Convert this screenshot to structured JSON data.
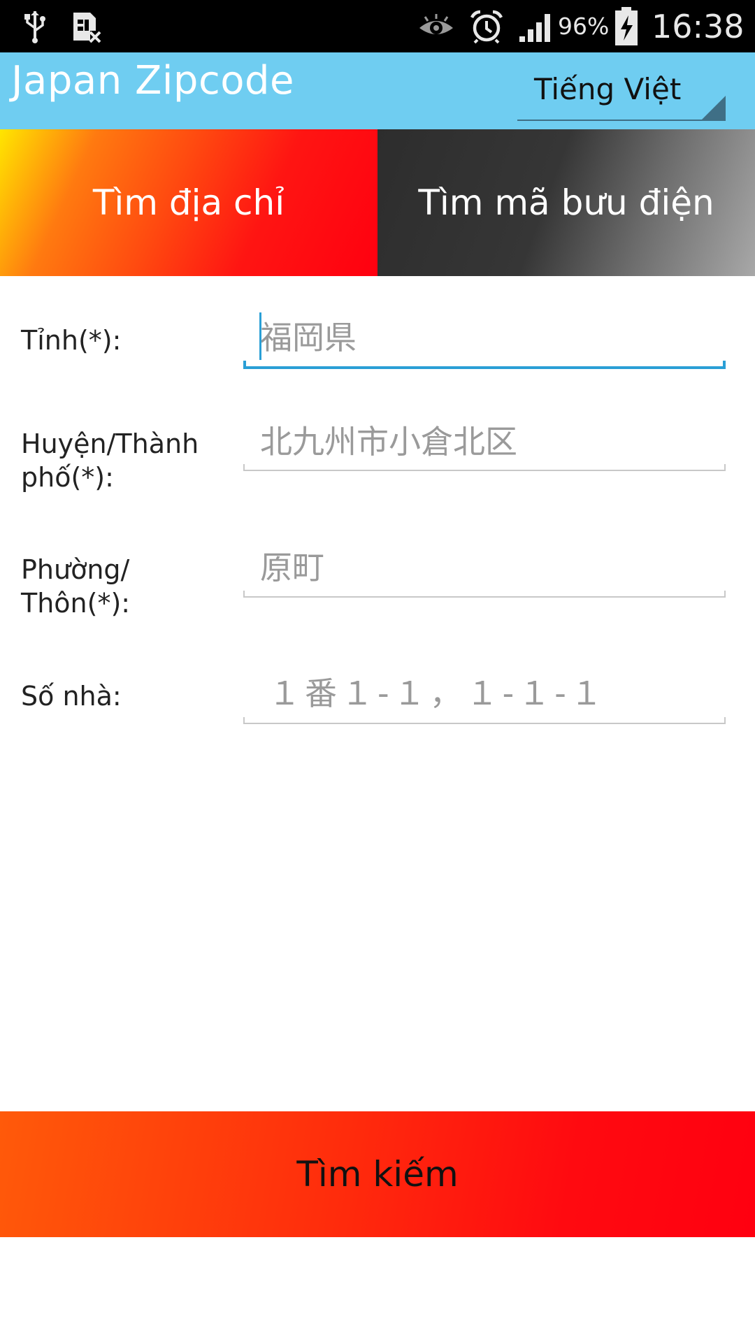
{
  "status_bar": {
    "icons": [
      "usb-icon",
      "sim-card-icon",
      "eye-icon",
      "alarm-icon",
      "signal-icon",
      "battery-charging-icon"
    ],
    "battery_percent": "96%",
    "time": "16:38"
  },
  "action_bar": {
    "title": "Japan Zipcode",
    "language": "Tiếng Việt"
  },
  "tabs": [
    {
      "label": "Tìm địa chỉ",
      "selected": true
    },
    {
      "label": "Tìm mã bưu điện",
      "selected": false
    }
  ],
  "form": {
    "prefecture": {
      "label": "Tỉnh(*):",
      "value": "",
      "placeholder": "福岡県"
    },
    "city": {
      "label_line1": "Huyện/Thành",
      "label_line2": "phố(*):",
      "value": "",
      "placeholder": "北九州市小倉北区"
    },
    "town": {
      "label_line1": "Phường/",
      "label_line2": "Thôn(*):",
      "value": "",
      "placeholder": "原町"
    },
    "address_number": {
      "label": "Số nhà:",
      "value": "",
      "placeholder": "１番１-１，１-１-１"
    }
  },
  "search_button": {
    "label": "Tìm kiếm"
  },
  "colors": {
    "action_bar": "#6fcdf1",
    "focus_accent": "#2a9fd6",
    "tab_selected_start": "#ffe600",
    "tab_selected_end": "#ff0010",
    "tab_unselected_start": "#2d2d2d",
    "tab_unselected_end": "#a8a8a8"
  }
}
